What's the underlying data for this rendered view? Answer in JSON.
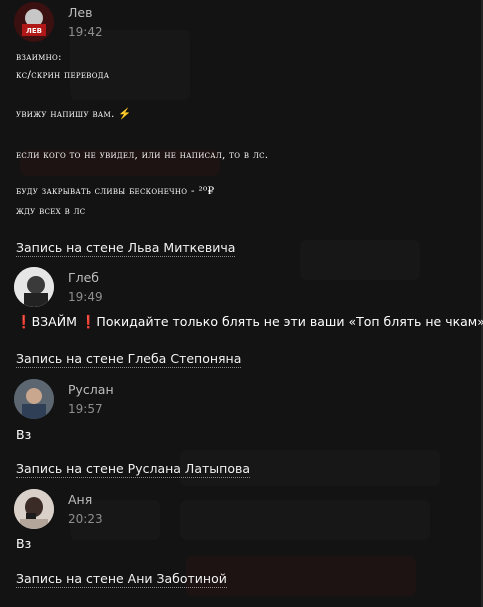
{
  "posts": [
    {
      "author": "Лев",
      "time": "19:42",
      "avatar_badge": "ЛЕВ",
      "lines": [
        "взаимно:",
        "кс/скрин перевода",
        "увижу напишу вам.",
        "если кого то не увидел, или не написал, то в лс.",
        "буду закрывать сливы бесконечно - ²⁰₽",
        "жду всех в лс"
      ],
      "bolt": "⚡",
      "wall_link": "Запись на стене Льва Миткевича"
    },
    {
      "author": "Глеб",
      "time": "19:49",
      "mark": "❗",
      "text_keyword": "ВЗАЙМ",
      "text_rest": "Покидайте только блять не эти ваши «Топ блять не чкам»",
      "wall_link": "Запись на стене Глеба Степоняна"
    },
    {
      "author": "Руслан",
      "time": "19:57",
      "text": "Вз",
      "wall_link": "Запись на стене Руслана Латыпова"
    },
    {
      "author": "Аня",
      "time": "20:23",
      "text": "Вз",
      "wall_link": "Запись на стене Ани Заботиной"
    }
  ]
}
